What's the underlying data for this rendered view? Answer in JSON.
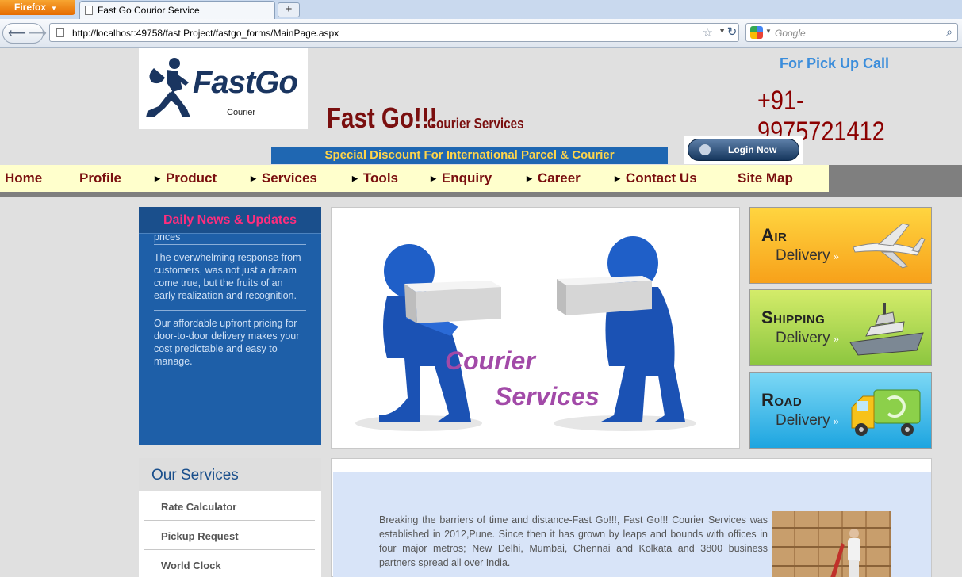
{
  "browser": {
    "app_button": "Firefox",
    "tab_title": "Fast Go Courior Service",
    "new_tab": "+",
    "url": "http://localhost:49758/fast Project/fastgo_forms/MainPage.aspx",
    "search_placeholder": "Google"
  },
  "header": {
    "logo_text": "FastGo",
    "logo_sub": "Courier",
    "brand": "Fast Go!!!",
    "brand_sub": "Courier Services",
    "pickup_label": "For Pick Up Call",
    "phone": "+91-9975721412",
    "discount_banner": "Special Discount For International Parcel  & Courier",
    "login_button": "Login Now"
  },
  "menu": [
    {
      "label": "Home",
      "arrow": false
    },
    {
      "label": "Profile",
      "arrow": false
    },
    {
      "label": "Product",
      "arrow": true
    },
    {
      "label": "Services",
      "arrow": true
    },
    {
      "label": "Tools",
      "arrow": true
    },
    {
      "label": "Enquiry",
      "arrow": true
    },
    {
      "label": "Career",
      "arrow": true
    },
    {
      "label": "Contact Us",
      "arrow": true
    },
    {
      "label": "Site Map",
      "arrow": false
    }
  ],
  "news": {
    "title": "Daily News & Updates",
    "cut_text": "prices",
    "items": [
      "The overwhelming response from customers, was not just a dream come true, but the fruits of an early realization and recognition.",
      "Our affordable upfront pricing for door-to-door delivery makes your cost predictable and easy to manage."
    ]
  },
  "hero": {
    "line1": "Courier",
    "line2": "Services"
  },
  "tiles": [
    {
      "title": "Air",
      "sub": "Delivery"
    },
    {
      "title": "Shipping",
      "sub": "Delivery"
    },
    {
      "title": "Road",
      "sub": "Delivery"
    }
  ],
  "services": {
    "title": "Our Services",
    "items": [
      "Rate Calculator",
      "Pickup Request",
      "World Clock"
    ]
  },
  "about": {
    "text": "Breaking the barriers of time and distance-Fast Go!!!, Fast Go!!! Courier Services was established in 2012,Pune. Since then it has grown by leaps and bounds with offices in four major metros; New Delhi, Mumbai, Chennai and Kolkata and 3800 business partners spread all over India."
  },
  "colors": {
    "brand_red": "#7a0f0f",
    "menu_bg": "#ffffcc",
    "news_bg": "#1e5fa8",
    "news_title": "#ff2d7d",
    "pickup_blue": "#3b8ddb"
  }
}
